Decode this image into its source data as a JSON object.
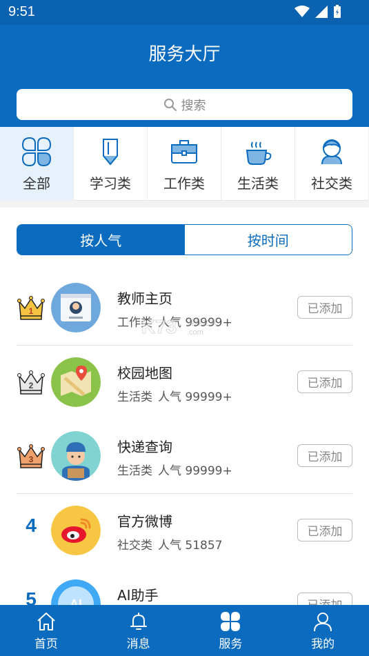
{
  "status": {
    "time": "9:51"
  },
  "header": {
    "title": "服务大厅"
  },
  "search": {
    "placeholder": "搜索"
  },
  "categories": [
    {
      "label": "全部",
      "icon": "grid-icon",
      "active": true
    },
    {
      "label": "学习类",
      "icon": "pencil-icon",
      "active": false
    },
    {
      "label": "工作类",
      "icon": "briefcase-icon",
      "active": false
    },
    {
      "label": "生活类",
      "icon": "cup-icon",
      "active": false
    },
    {
      "label": "社交类",
      "icon": "person-icon",
      "active": false
    }
  ],
  "toggle": {
    "popularity": "按人气",
    "time": "按时间",
    "selected": "popularity"
  },
  "services": [
    {
      "rank": "1",
      "name": "教师主页",
      "category": "工作类",
      "popularity": "人气 99999+",
      "button": "已添加",
      "avatar": "teacher-page-avatar"
    },
    {
      "rank": "2",
      "name": "校园地图",
      "category": "生活类",
      "popularity": "人气 99999+",
      "button": "已添加",
      "avatar": "campus-map-avatar"
    },
    {
      "rank": "3",
      "name": "快递查询",
      "category": "生活类",
      "popularity": "人气 99999+",
      "button": "已添加",
      "avatar": "courier-avatar"
    },
    {
      "rank": "4",
      "name": "官方微博",
      "category": "社交类",
      "popularity": "人气 51857",
      "button": "已添加",
      "avatar": "weibo-avatar"
    },
    {
      "rank": "5",
      "name": "AI助手",
      "category": "",
      "popularity": "",
      "button": "已添加",
      "avatar": "ai-assistant-avatar"
    }
  ],
  "watermark": {
    "text": "K73 游戏之家 .com"
  },
  "bottom_nav": [
    {
      "label": "首页",
      "icon": "home-icon"
    },
    {
      "label": "消息",
      "icon": "bell-icon"
    },
    {
      "label": "服务",
      "icon": "services-icon",
      "active": true
    },
    {
      "label": "我的",
      "icon": "profile-icon"
    }
  ],
  "colors": {
    "primary": "#0A6BBF",
    "active_category_bg": "#E6F1FB",
    "crown_gold": "#F5C542"
  }
}
